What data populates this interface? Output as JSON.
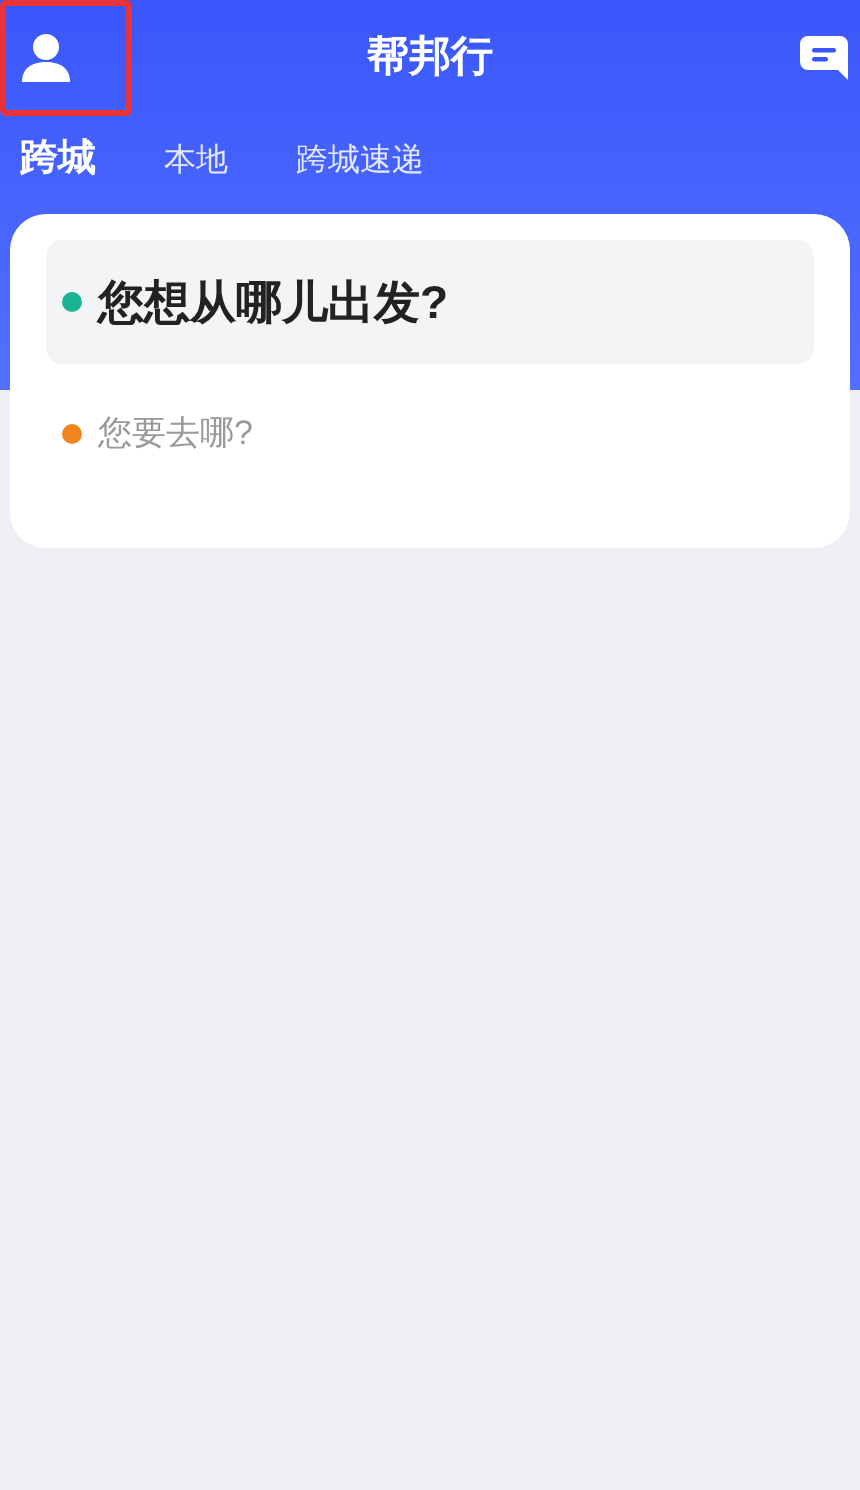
{
  "header": {
    "title": "帮邦行",
    "profile_button": {
      "highlighted": true
    }
  },
  "tabs": [
    {
      "label": "跨城",
      "selected": true
    },
    {
      "label": "本地",
      "selected": false
    },
    {
      "label": "跨城速递",
      "selected": false
    }
  ],
  "route": [
    {
      "text": "您想从哪儿出发?",
      "selected": true,
      "color": "#1ab394"
    },
    {
      "text": "您要去哪?",
      "selected": false,
      "color": "#f0851c"
    }
  ]
}
